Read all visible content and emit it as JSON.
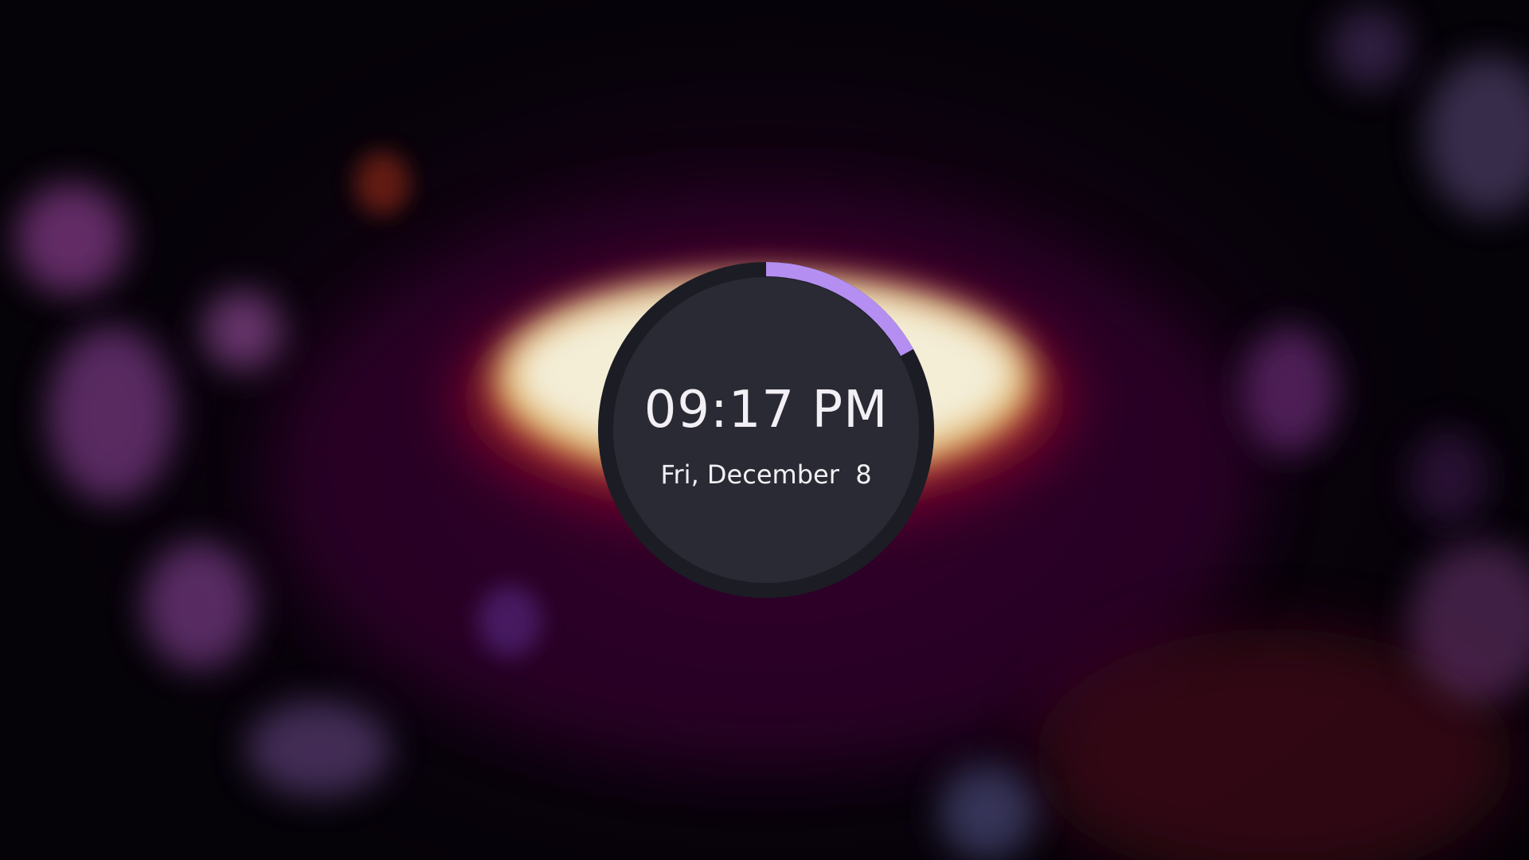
{
  "lockscreen": {
    "clock": {
      "time": "09:17 PM",
      "date": "Fri, December  8",
      "seconds_progress": 0.17
    }
  },
  "colors": {
    "ring_track": "#1c1c24",
    "face": "#2a2a34",
    "progress_arc": "#b48ef0",
    "glow_core": "#f6f3e0",
    "glow_mid": "#f2e58a",
    "glow_edge": "#a0102a"
  }
}
